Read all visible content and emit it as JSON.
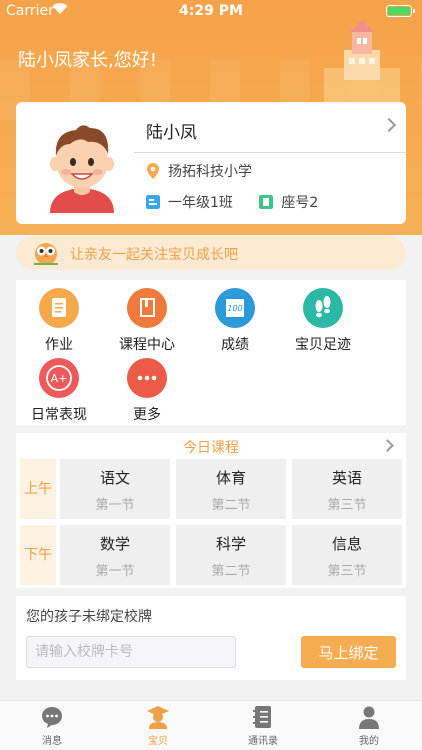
{
  "status_bar": {
    "carrier": "Carrier",
    "time": "4:29 PM"
  },
  "header": {
    "greeting": "陆小凤家长,您好!"
  },
  "child": {
    "name": "陆小凤",
    "school": "扬拓科技小学",
    "class": "一年级1班",
    "seat": "座号2"
  },
  "invite": {
    "text": "让亲友一起关注宝贝成长吧"
  },
  "menu": {
    "items": [
      {
        "label": "作业",
        "icon": "homework-icon",
        "color": "#f6a94b"
      },
      {
        "label": "课程中心",
        "icon": "course-book-icon",
        "color": "#f07a3c"
      },
      {
        "label": "成绩",
        "icon": "grade-sheet-icon",
        "color": "#2c9ad8"
      },
      {
        "label": "宝贝足迹",
        "icon": "footprints-icon",
        "color": "#2bb9a5"
      },
      {
        "label": "日常表现",
        "icon": "a-plus-icon",
        "color": "#ec5b5b"
      },
      {
        "label": "更多",
        "icon": "more-dots-icon",
        "color": "#ec5b47"
      }
    ]
  },
  "courses": {
    "title": "今日课程",
    "periods": [
      "上午",
      "下午"
    ],
    "morning": [
      {
        "subject": "语文",
        "slot": "第一节"
      },
      {
        "subject": "体育",
        "slot": "第二节"
      },
      {
        "subject": "英语",
        "slot": "第三节"
      }
    ],
    "afternoon": [
      {
        "subject": "数学",
        "slot": "第一节"
      },
      {
        "subject": "科学",
        "slot": "第二节"
      },
      {
        "subject": "信息",
        "slot": "第三节"
      }
    ]
  },
  "bind": {
    "prompt": "您的孩子未绑定校牌",
    "placeholder": "请输入校牌卡号",
    "button": "马上绑定"
  },
  "tabbar": {
    "items": [
      {
        "label": "消息",
        "icon": "message-bubble-icon"
      },
      {
        "label": "宝贝",
        "icon": "student-icon"
      },
      {
        "label": "通讯录",
        "icon": "contacts-book-icon"
      },
      {
        "label": "我的",
        "icon": "person-icon"
      }
    ],
    "active": "宝贝"
  },
  "colors": {
    "accent": "#f6a24a",
    "active_tab": "#f0a046"
  }
}
